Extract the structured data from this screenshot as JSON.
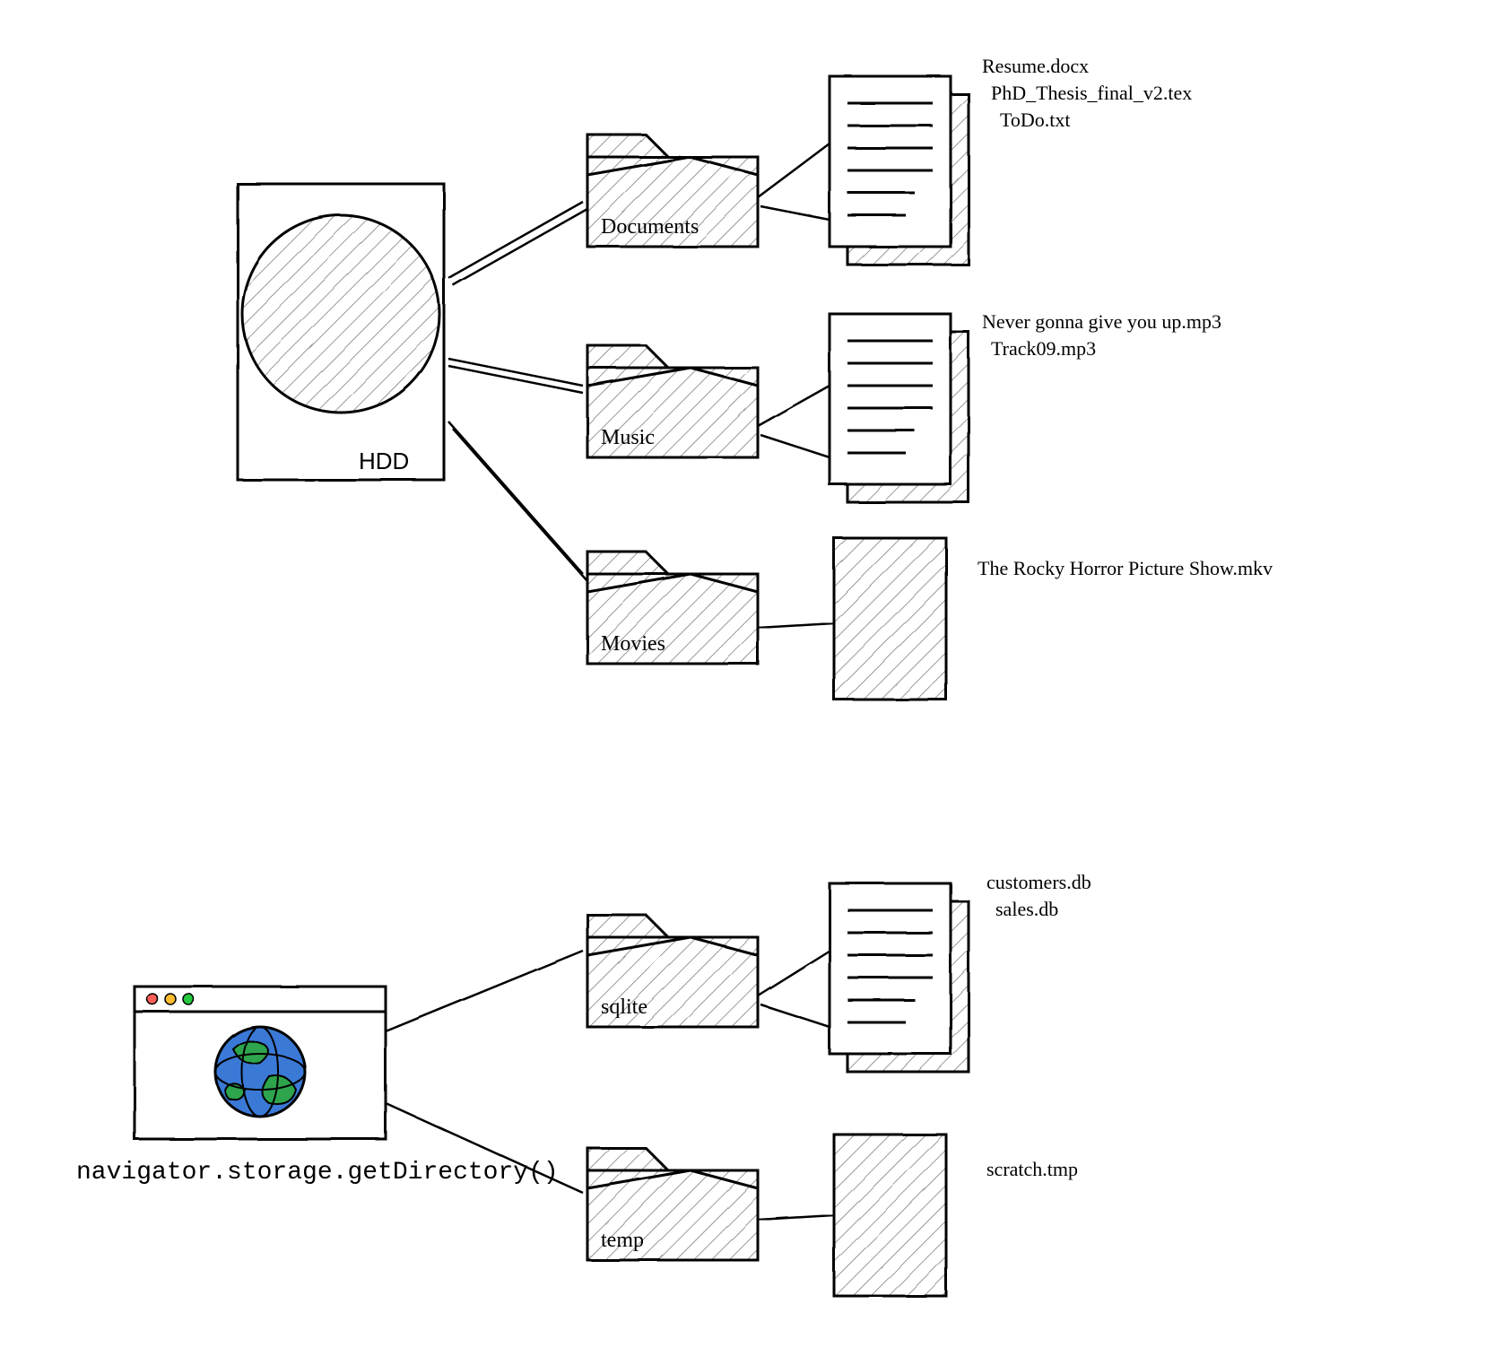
{
  "hdd": {
    "label": "HDD",
    "folders": [
      {
        "name": "Documents",
        "files": [
          "Resume.docx",
          "PhD_Thesis_final_v2.tex",
          "ToDo.txt"
        ]
      },
      {
        "name": "Music",
        "files": [
          "Never gonna give you up.mp3",
          "Track09.mp3"
        ]
      },
      {
        "name": "Movies",
        "files": [
          "The Rocky Horror Picture Show.mkv"
        ]
      }
    ]
  },
  "browser": {
    "api_call": "navigator.storage.getDirectory()",
    "folders": [
      {
        "name": "sqlite",
        "files": [
          "customers.db",
          "sales.db"
        ]
      },
      {
        "name": "temp",
        "files": [
          "scratch.tmp"
        ]
      }
    ]
  }
}
